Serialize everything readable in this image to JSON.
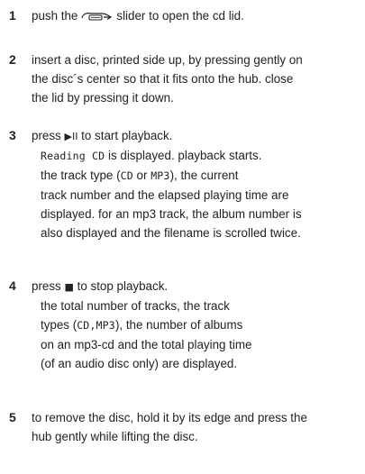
{
  "steps": [
    {
      "number": "1",
      "pre": "push the",
      "icon": "slider-icon",
      "post": "slider to open the cd lid."
    },
    {
      "number": "2",
      "lines": [
        "insert a disc, printed side up, by pressing gently on",
        "the disc´s center so that it fits onto the hub. close",
        "the lid by pressing it down."
      ]
    },
    {
      "number": "3",
      "pre": "press",
      "glyph": "▶II",
      "post": "to start playback.",
      "display_text": "Reading CD",
      "display_suffix": "is displayed. playback starts.",
      "line_a_pre": "the track type (",
      "line_a_cd": "CD",
      "line_a_or": " or ",
      "line_a_mp3": "MP3",
      "line_a_post": "), the current",
      "lines": [
        "track number and the elapsed playing time are",
        "displayed. for an mp3 track, the album number is",
        "also displayed and the filename is scrolled twice."
      ]
    },
    {
      "number": "4",
      "pre": "press",
      "glyph": "■",
      "post": "to stop playback.",
      "line_a": "the total number of tracks, the track",
      "line_b_pre": "types (",
      "line_b_code": "CD,MP3",
      "line_b_post": "), the number of albums",
      "lines": [
        "on an mp3-cd and the total playing time",
        "(of an audio disc only) are displayed."
      ]
    },
    {
      "number": "5",
      "lines": [
        "to remove the disc, hold it by its edge and press the",
        "hub gently while lifting the disc."
      ]
    }
  ]
}
